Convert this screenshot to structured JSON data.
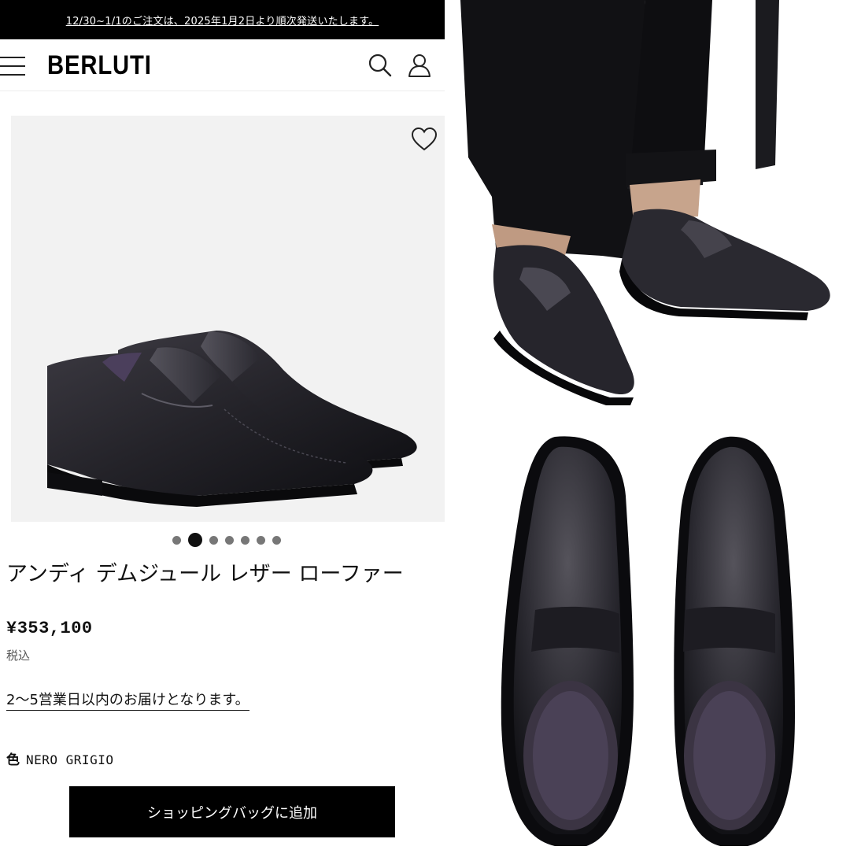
{
  "banner": {
    "text": "12/30~1/1のご注文は、2025年1月2日より順次発送いたします。"
  },
  "header": {
    "logo": "BERLUTI",
    "icons": [
      "menu-icon",
      "search-icon",
      "account-icon"
    ]
  },
  "gallery": {
    "wishlist_icon": "heart-icon",
    "dot_count": 7,
    "active_dot_index": 1
  },
  "product": {
    "title": "アンディ デムジュール レザー ローファー",
    "price": "¥353,100",
    "tax_note": "税込",
    "delivery": "2〜5営業日以内のお届けとなります。",
    "color_label": "色",
    "color_value": "NERO GRIGIO"
  },
  "cta": {
    "add_to_bag": "ショッピングバッグに追加"
  },
  "colors": {
    "banner_bg": "#000000",
    "button_bg": "#000000",
    "leather": "#2a2930",
    "lining": "#4b3f5c"
  }
}
